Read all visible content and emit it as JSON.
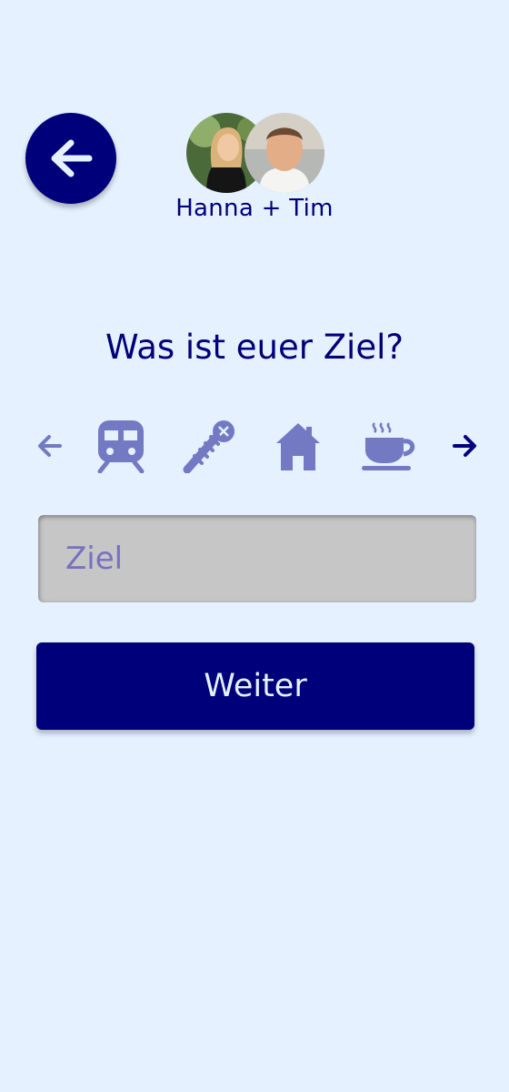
{
  "header": {
    "back_icon": "arrow-left-icon",
    "participants": "Hanna + Tim",
    "avatars": [
      {
        "name": "Hanna",
        "icon": "avatar-photo"
      },
      {
        "name": "Tim",
        "icon": "avatar-photo"
      }
    ]
  },
  "main": {
    "question": "Was ist euer Ziel?",
    "categories": [
      {
        "icon": "train-icon"
      },
      {
        "icon": "screw-icon"
      },
      {
        "icon": "house-icon"
      },
      {
        "icon": "coffee-cup-icon"
      }
    ],
    "input": {
      "value": "",
      "placeholder": "Ziel"
    },
    "submit_label": "Weiter"
  },
  "colors": {
    "background": "#e5f1fe",
    "primary": "#00007a",
    "icon_muted": "#7479c4",
    "input_bg": "#c6c6c6"
  }
}
